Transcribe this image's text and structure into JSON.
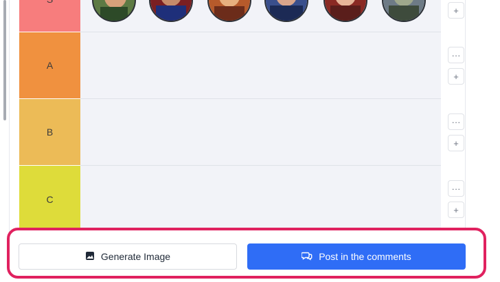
{
  "tiers": [
    {
      "label": "S",
      "color": "#f77d7d"
    },
    {
      "label": "A",
      "color": "#f0913f"
    },
    {
      "label": "B",
      "color": "#ecbb57"
    },
    {
      "label": "C",
      "color": "#dedc3a"
    }
  ],
  "row_controls": {
    "more_label": "···",
    "add_label": "+"
  },
  "footer": {
    "generate_label": "Generate Image",
    "post_label": "Post in the comments"
  },
  "colors": {
    "highlight_border": "#e0215f",
    "primary": "#2f6df6"
  },
  "icons": {
    "generate": "image-icon",
    "post": "comments-icon"
  }
}
